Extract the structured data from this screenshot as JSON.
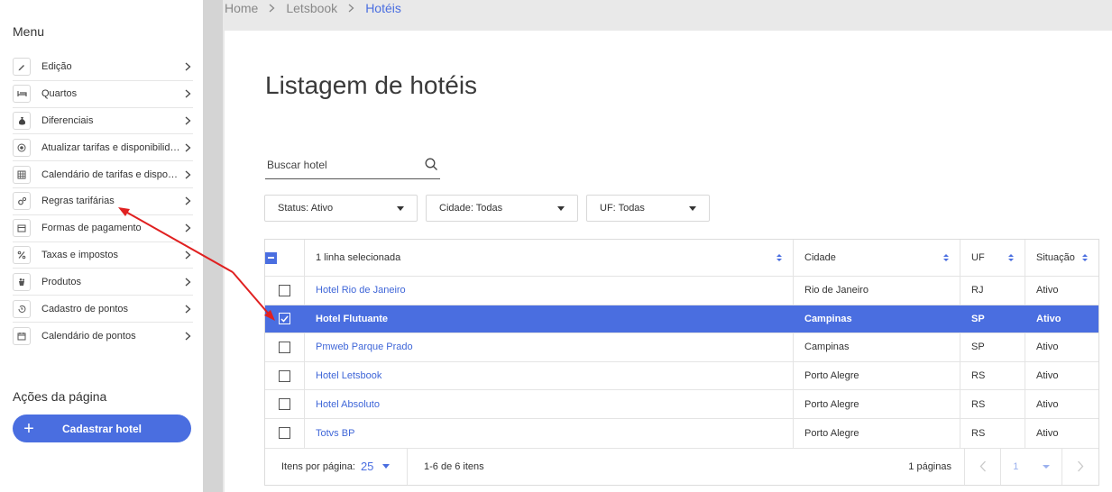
{
  "sidebar": {
    "menu_title": "Menu",
    "items": [
      {
        "label": "Edição",
        "icon": "pencil-icon"
      },
      {
        "label": "Quartos",
        "icon": "bed-icon"
      },
      {
        "label": "Diferenciais",
        "icon": "money-bag-icon"
      },
      {
        "label": "Atualizar tarifas e disponibilidade",
        "icon": "target-icon"
      },
      {
        "label": "Calendário de tarifas e disponibilidade",
        "icon": "calendar-grid-icon"
      },
      {
        "label": "Regras tarifárias",
        "icon": "gears-icon"
      },
      {
        "label": "Formas de pagamento",
        "icon": "wallet-icon"
      },
      {
        "label": "Taxas e impostos",
        "icon": "percent-icon"
      },
      {
        "label": "Produtos",
        "icon": "products-icon"
      },
      {
        "label": "Cadastro de pontos",
        "icon": "history-icon"
      },
      {
        "label": "Calendário de pontos",
        "icon": "calendar-icon"
      }
    ],
    "actions_title": "Ações da página",
    "cadastrar_label": "Cadastrar hotel"
  },
  "breadcrumb": {
    "items": [
      "Home",
      "Letsbook"
    ],
    "current": "Hotéis"
  },
  "page_title": "Listagem de hotéis",
  "search": {
    "placeholder": "Buscar hotel"
  },
  "filters": [
    {
      "label": "Status: Ativo"
    },
    {
      "label": "Cidade: Todas"
    },
    {
      "label": "UF: Todas"
    }
  ],
  "table": {
    "headers": {
      "name": "1 linha selecionada",
      "city": "Cidade",
      "uf": "UF",
      "status": "Situação"
    },
    "rows": [
      {
        "name": "Hotel Rio de Janeiro",
        "city": "Rio de Janeiro",
        "uf": "RJ",
        "status": "Ativo",
        "selected": false
      },
      {
        "name": "Hotel Flutuante",
        "city": "Campinas",
        "uf": "SP",
        "status": "Ativo",
        "selected": true
      },
      {
        "name": "Pmweb Parque Prado",
        "city": "Campinas",
        "uf": "SP",
        "status": "Ativo",
        "selected": false
      },
      {
        "name": "Hotel Letsbook",
        "city": "Porto Alegre",
        "uf": "RS",
        "status": "Ativo",
        "selected": false
      },
      {
        "name": "Hotel Absoluto",
        "city": "Porto Alegre",
        "uf": "RS",
        "status": "Ativo",
        "selected": false
      },
      {
        "name": "Totvs BP",
        "city": "Porto Alegre",
        "uf": "RS",
        "status": "Ativo",
        "selected": false
      }
    ]
  },
  "pagination": {
    "per_page_label": "Itens por página:",
    "per_page_value": "25",
    "range": "1-6 de 6 itens",
    "pages_label": "1 páginas",
    "current_page": "1"
  },
  "colors": {
    "accent": "#4a6ee0",
    "annotation_arrow": "#e02020"
  }
}
